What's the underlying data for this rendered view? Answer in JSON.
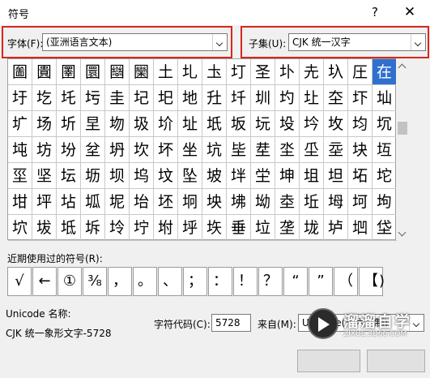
{
  "window": {
    "title": "符号",
    "help": "?",
    "close": "✕"
  },
  "font": {
    "label": "字体(F):",
    "value": "(亚洲语言文本)"
  },
  "subset": {
    "label": "子集(U):",
    "value": "CJK 统一汉字"
  },
  "grid": {
    "rows": [
      [
        "圗",
        "圚",
        "圛",
        "圜",
        "圝",
        "圞",
        "土",
        "圠",
        "圡",
        "圢",
        "圣",
        "圤",
        "圥",
        "圦",
        "圧",
        "在"
      ],
      [
        "圩",
        "圪",
        "圫",
        "圬",
        "圭",
        "圮",
        "圯",
        "地",
        "圱",
        "圲",
        "圳",
        "圴",
        "圵",
        "圶",
        "圷",
        "圸"
      ],
      [
        "圹",
        "场",
        "圻",
        "圼",
        "圽",
        "圾",
        "圿",
        "址",
        "坁",
        "坂",
        "坃",
        "坄",
        "坅",
        "坆",
        "均",
        "坈"
      ],
      [
        "坉",
        "坊",
        "坋",
        "坌",
        "坍",
        "坎",
        "坏",
        "坐",
        "坑",
        "坒",
        "坓",
        "坔",
        "坕",
        "坖",
        "块",
        "坘"
      ],
      [
        "坙",
        "坚",
        "坛",
        "坜",
        "坝",
        "坞",
        "坟",
        "坠",
        "坡",
        "坢",
        "坣",
        "坤",
        "坥",
        "坦",
        "坧",
        "坨"
      ],
      [
        "坩",
        "坪",
        "坫",
        "坬",
        "坭",
        "坮",
        "坯",
        "坰",
        "坱",
        "坲",
        "坳",
        "坴",
        "坵",
        "坶",
        "坷",
        "坸"
      ],
      [
        "坹",
        "坺",
        "坻",
        "坼",
        "坽",
        "坾",
        "坿",
        "垀",
        "垁",
        "垂",
        "垃",
        "垄",
        "垅",
        "垆",
        "垇",
        "垈"
      ]
    ],
    "selected_row": 0,
    "selected_col": 15
  },
  "recent": {
    "label": "近期使用过的符号(R):",
    "symbols": [
      "√",
      "←",
      "①",
      "⅜",
      "，",
      "。",
      "、",
      "；",
      "：",
      "！",
      "？",
      "“",
      "”",
      "（",
      "【"
    ],
    "trailing": ")"
  },
  "unicode": {
    "name_label": "Unicode 名称:",
    "name_value": "CJK 统一象形文字-5728"
  },
  "charcode": {
    "label": "字符代码(C):",
    "value": "5728"
  },
  "from": {
    "label": "来自(M):",
    "value": "Unicode(十六进制)"
  },
  "watermark": {
    "name": "溜溜自学",
    "url": "ZIXUE.3D66.COM"
  }
}
